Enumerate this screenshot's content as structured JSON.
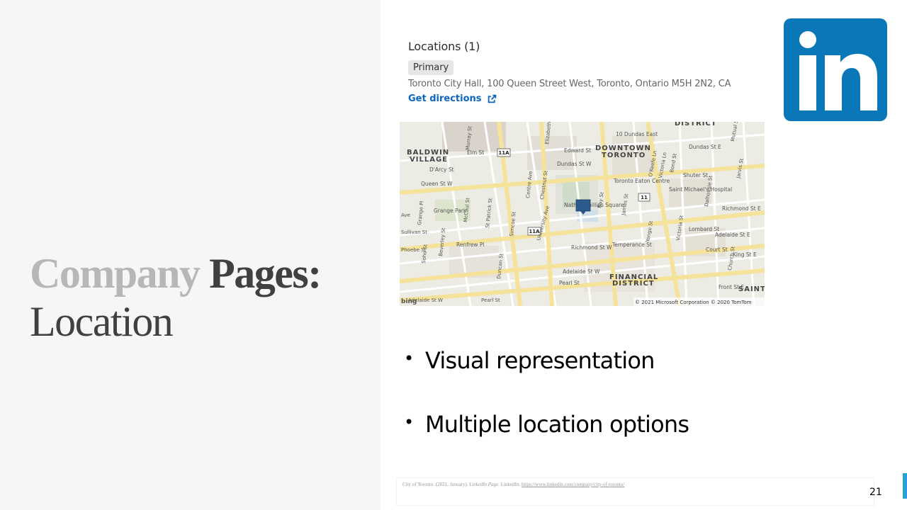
{
  "slide": {
    "title_part1": "Company",
    "title_part2": "Pages:",
    "title_part3": "Location",
    "page_number": "21",
    "accent_color": "#29a1d6"
  },
  "locations": {
    "heading": "Locations (1)",
    "badge": "Primary",
    "address": "Toronto City Hall, 100 Queen Street West, Toronto, Ontario M5H 2N2, CA",
    "link_label": "Get directions",
    "link_icon": "external-link-icon",
    "link_color": "#0a66c2"
  },
  "logo": {
    "text": "in",
    "bg_color": "#0a78b8"
  },
  "map": {
    "attribution": "© 2021 Microsoft Corporation © 2020 TomTom",
    "provider": "bing",
    "districts": [
      "BALDWIN",
      "VILLAGE",
      "DOWNTOWN",
      "TORONTO",
      "FINANCIAL",
      "DISTRICT",
      "SAINT",
      "DISTRICT"
    ],
    "labels": [
      "Elm St",
      "Edward St",
      "Dundas St W",
      "Dundas St E",
      "D'Arcy St",
      "Shuter St",
      "Grange Park",
      "Richmond St W",
      "Richmond St E",
      "Adelaide St W",
      "Adelaide St E",
      "Temperance St",
      "Lombard St",
      "Court St",
      "King St E",
      "Pearl St",
      "Front St E",
      "Renfrew Pl",
      "Queen St W",
      "10 Dundas East",
      "Toronto Eaton Centre",
      "Saint Michael's Hospital",
      "Nathan Phillips Square",
      "Yonge St",
      "Bay St",
      "James St",
      "Victoria St",
      "Church St",
      "Jarvis St",
      "Mutual St",
      "Dalhousie St",
      "Bond St",
      "O'Keefe Ln",
      "Victoria Ln",
      "Chestnut St",
      "Centre Ave",
      "University Ave",
      "Simcoe St",
      "St Patrick St",
      "McCaul St",
      "Beverley St",
      "Soho St",
      "Grange Pl",
      "Sullivan St",
      "Phoebe St",
      "Duncan St",
      "Murray St",
      "Elizabeth St",
      "Ave",
      "Pearl St",
      "Adelaide St W"
    ],
    "route_shields": [
      "11A",
      "11A",
      "11"
    ]
  },
  "bullets": [
    "Visual representation",
    "Multiple location options"
  ],
  "citation": {
    "prefix": "City of Toronto. (2021, January). ",
    "italic": "LinkedIn Page.",
    "middle": " LinkedIn. ",
    "url": "https://www.linkedin.com/company/city-of-toronto/"
  }
}
